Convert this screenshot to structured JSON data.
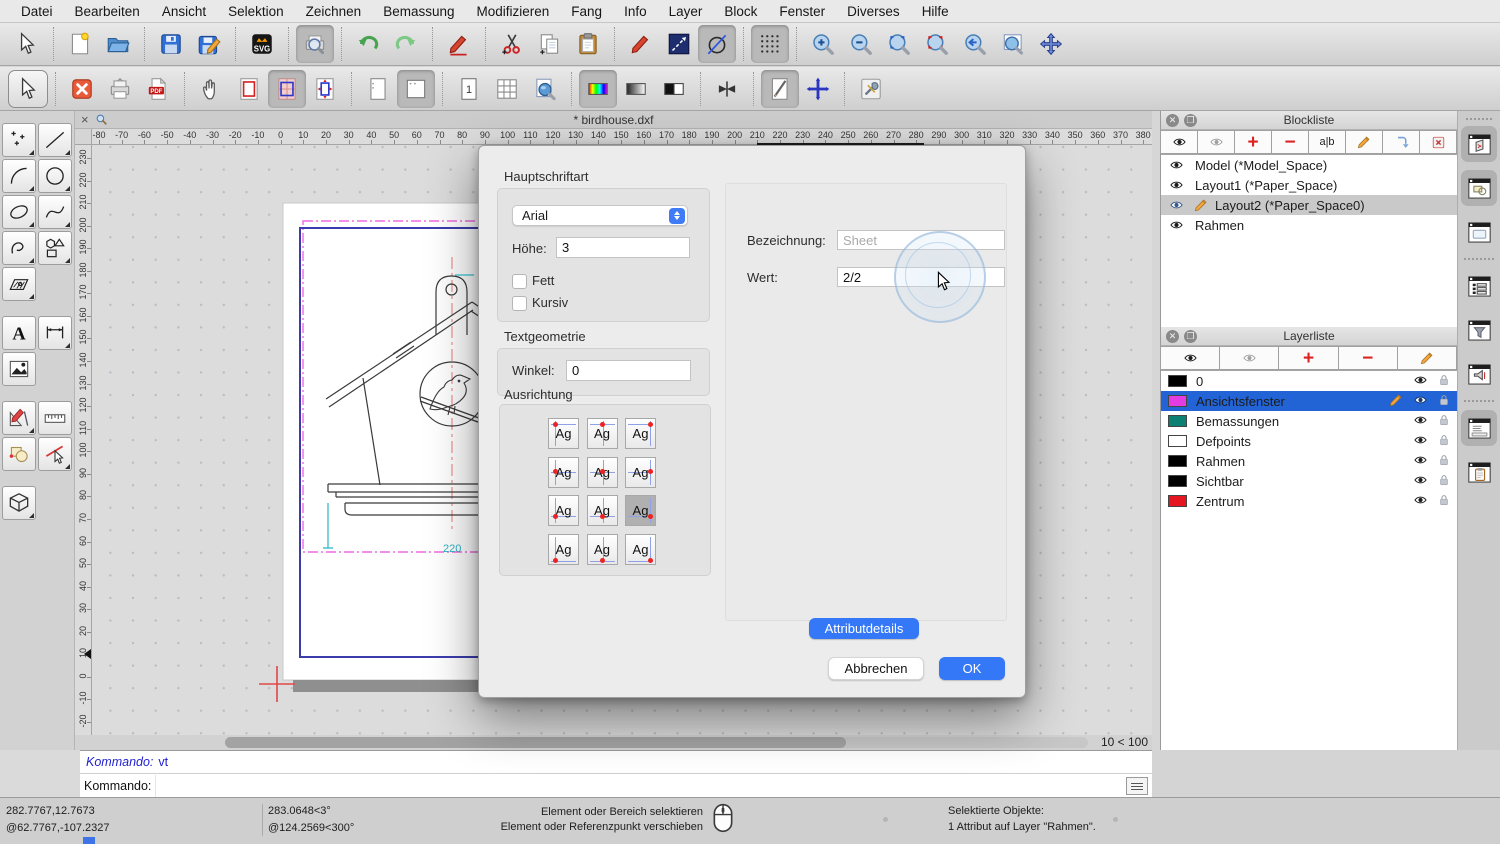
{
  "menu": {
    "items": [
      "Datei",
      "Bearbeiten",
      "Ansicht",
      "Selektion",
      "Zeichnen",
      "Bemassung",
      "Modifizieren",
      "Fang",
      "Info",
      "Layer",
      "Block",
      "Fenster",
      "Diverses",
      "Hilfe"
    ]
  },
  "toolbar_main": {
    "buttons": [
      {
        "name": "pointer"
      },
      {
        "sep": true
      },
      {
        "name": "file-new"
      },
      {
        "name": "folder-open"
      },
      {
        "sep": true
      },
      {
        "name": "save"
      },
      {
        "name": "save-as"
      },
      {
        "sep": true
      },
      {
        "name": "svg-export"
      },
      {
        "sep": true
      },
      {
        "name": "print-preview",
        "active": true
      },
      {
        "sep": true
      },
      {
        "name": "undo"
      },
      {
        "name": "redo"
      },
      {
        "sep": true
      },
      {
        "name": "pen-edit"
      },
      {
        "sep": true
      },
      {
        "name": "cut"
      },
      {
        "name": "copy"
      },
      {
        "name": "paste"
      },
      {
        "sep": true
      },
      {
        "name": "pen-red"
      },
      {
        "name": "line-tool"
      },
      {
        "name": "circle-slash",
        "active": true
      },
      {
        "sep": true
      },
      {
        "name": "grid-dots",
        "active": true
      },
      {
        "sep": true
      },
      {
        "name": "zoom-in"
      },
      {
        "name": "zoom-out"
      },
      {
        "name": "zoom-fit"
      },
      {
        "name": "zoom-selection"
      },
      {
        "name": "zoom-previous"
      },
      {
        "name": "zoom-window"
      },
      {
        "name": "pan"
      }
    ]
  },
  "toolbar_view": {
    "buttons": [
      {
        "name": "pointer-select",
        "framed": true
      },
      {
        "sep": true
      },
      {
        "name": "close-drawing"
      },
      {
        "name": "print"
      },
      {
        "name": "pdf-export"
      },
      {
        "sep": true
      },
      {
        "name": "pan-hand"
      },
      {
        "name": "viewport-frame"
      },
      {
        "name": "viewport-fill",
        "active": true
      },
      {
        "name": "viewport-arrows"
      },
      {
        "sep": true
      },
      {
        "name": "page-plain"
      },
      {
        "name": "page-current",
        "active": true
      },
      {
        "sep": true
      },
      {
        "name": "page-one"
      },
      {
        "name": "page-grid"
      },
      {
        "name": "zoom-page"
      },
      {
        "sep": true
      },
      {
        "name": "color-full",
        "active": true
      },
      {
        "name": "color-gray"
      },
      {
        "name": "color-bw"
      },
      {
        "sep": true
      },
      {
        "name": "lineweight"
      },
      {
        "sep": true
      },
      {
        "name": "draft-mode",
        "active": true
      },
      {
        "name": "crosshair"
      },
      {
        "sep": true
      },
      {
        "name": "preferences"
      }
    ]
  },
  "palette": {
    "rows": [
      [
        "points",
        "line"
      ],
      [
        "arc",
        "circle"
      ],
      [
        "ellipse",
        "spline"
      ],
      [
        "polyline",
        "shapes"
      ],
      [
        "hatch"
      ],
      null,
      [
        "text",
        "dimension"
      ],
      [
        "image"
      ],
      null,
      [
        "cad-tools",
        "measure"
      ],
      [
        "modify",
        "select-entity"
      ],
      null,
      [
        "solid"
      ]
    ]
  },
  "tab": {
    "close_glyph": "×",
    "title": "* birdhouse.dxf"
  },
  "rulers": {
    "horizontal": {
      "min": -80,
      "max": 380,
      "step": 10
    },
    "vertical": {
      "min": -20,
      "max": 230,
      "step": 10
    },
    "v_marker_value": 10
  },
  "drawing": {
    "dim_label": "220"
  },
  "canvas_footer": {
    "grid_label": "10 < 100"
  },
  "dialog": {
    "font_group": "Hauptschriftart",
    "font_value": "Arial",
    "height_label": "Höhe:",
    "height_value": "3",
    "bold_label": "Fett",
    "italic_label": "Kursiv",
    "geom_group": "Textgeometrie",
    "angle_label": "Winkel:",
    "angle_value": "0",
    "align_group": "Ausrichtung",
    "align_sample": "Ag",
    "alignment": {
      "selected_index": 8,
      "cells": [
        {
          "h": "left",
          "v": "top"
        },
        {
          "h": "center",
          "v": "top"
        },
        {
          "h": "right",
          "v": "top"
        },
        {
          "h": "left",
          "v": "middle"
        },
        {
          "h": "center",
          "v": "middle"
        },
        {
          "h": "right",
          "v": "middle"
        },
        {
          "h": "left",
          "v": "base"
        },
        {
          "h": "center",
          "v": "base"
        },
        {
          "h": "right",
          "v": "base"
        },
        {
          "h": "left",
          "v": "bottom"
        },
        {
          "h": "center",
          "v": "bottom"
        },
        {
          "h": "right",
          "v": "bottom"
        }
      ]
    },
    "designation_label": "Bezeichnung:",
    "designation_placeholder": "Sheet",
    "value_label": "Wert:",
    "value_text": "2/2",
    "details_button": "Attributdetails",
    "cancel_button": "Abbrechen",
    "ok_button": "OK"
  },
  "block_panel": {
    "title": "Blockliste",
    "rename_glyph": "a|b",
    "toolbar": [
      "visible-eye",
      "hidden-eye",
      "add",
      "remove",
      "rename",
      "edit",
      "insert",
      "delete"
    ],
    "rows": [
      {
        "label": "Model (*Model_Space)"
      },
      {
        "label": "Layout1 (*Paper_Space)"
      },
      {
        "label": "Layout2 (*Paper_Space0)",
        "selected": true
      },
      {
        "label": "Rahmen"
      }
    ]
  },
  "layer_panel": {
    "title": "Layerliste",
    "toolbar": [
      "visible-eye",
      "hidden-eye",
      "add",
      "remove",
      "edit"
    ],
    "rows": [
      {
        "label": "0",
        "color": "#000000"
      },
      {
        "label": "Ansichtsfenster",
        "color": "#e23ce2",
        "selected": true
      },
      {
        "label": "Bemassungen",
        "color": "#0d8074"
      },
      {
        "label": "Defpoints",
        "color": "#ffffff"
      },
      {
        "label": "Rahmen",
        "color": "#000000"
      },
      {
        "label": "Sichtbar",
        "color": "#000000"
      },
      {
        "label": "Zentrum",
        "color": "#e51522"
      }
    ]
  },
  "sidebar": {
    "buttons": [
      {
        "name": "panel-blocks",
        "active": true
      },
      {
        "name": "panel-library",
        "active": true
      },
      {
        "name": "panel-viewport"
      },
      {
        "sep": true
      },
      {
        "name": "panel-property-list"
      },
      {
        "name": "panel-filter"
      },
      {
        "name": "panel-dimension"
      },
      {
        "sep": true
      },
      {
        "name": "panel-command",
        "active": true
      },
      {
        "name": "panel-clipboard"
      }
    ]
  },
  "command": {
    "history_label": "Kommando:",
    "history_value": "vt",
    "prompt_label": "Kommando:"
  },
  "status": {
    "abs_coord": "282.7767,12.7673",
    "rel_coord": "@62.7767,-107.2327",
    "abs_polar": "283.0648<3°",
    "rel_polar": "@124.2569<300°",
    "hint_line1": "Element oder Bereich selektieren",
    "hint_line2": "Element oder Referenzpunkt verschieben",
    "selection_line1": "Selektierte Objekte:",
    "selection_line2": "1 Attribut auf Layer \"Rahmen\"."
  },
  "colors": {
    "accent": "#3478f7",
    "selection_blue": "#2263d5",
    "layer_selected": "#2263d5"
  }
}
